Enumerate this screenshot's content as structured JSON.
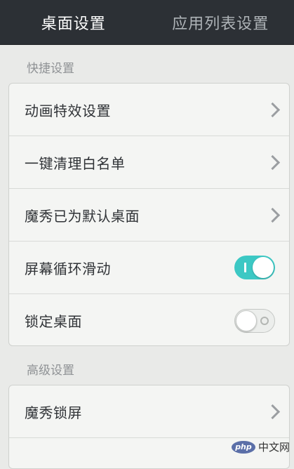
{
  "tabs": [
    {
      "label": "桌面设置",
      "active": true
    },
    {
      "label": "应用列表设置",
      "active": false
    }
  ],
  "quick_section": {
    "header": "快捷设置",
    "items": [
      {
        "label": "动画特效设置",
        "control": "chevron-right-icon"
      },
      {
        "label": "一键清理白名单",
        "control": "chevron-right-icon"
      },
      {
        "label": "魔秀已为默认桌面",
        "control": "chevron-right-icon"
      },
      {
        "label": "屏幕循环滑动",
        "control": "toggle",
        "state": "on"
      },
      {
        "label": "锁定桌面",
        "control": "toggle",
        "state": "off"
      }
    ]
  },
  "advanced_section": {
    "header": "高级设置",
    "items": [
      {
        "label": "魔秀锁屏",
        "control": "chevron-right-icon"
      }
    ]
  },
  "watermark": {
    "logo": "php",
    "text": "中文网"
  },
  "colors": {
    "topbar": "#2c3035",
    "accent_toggle_on": "#3cc8c4",
    "background": "#e9eae8",
    "card": "#f4f5f3"
  }
}
